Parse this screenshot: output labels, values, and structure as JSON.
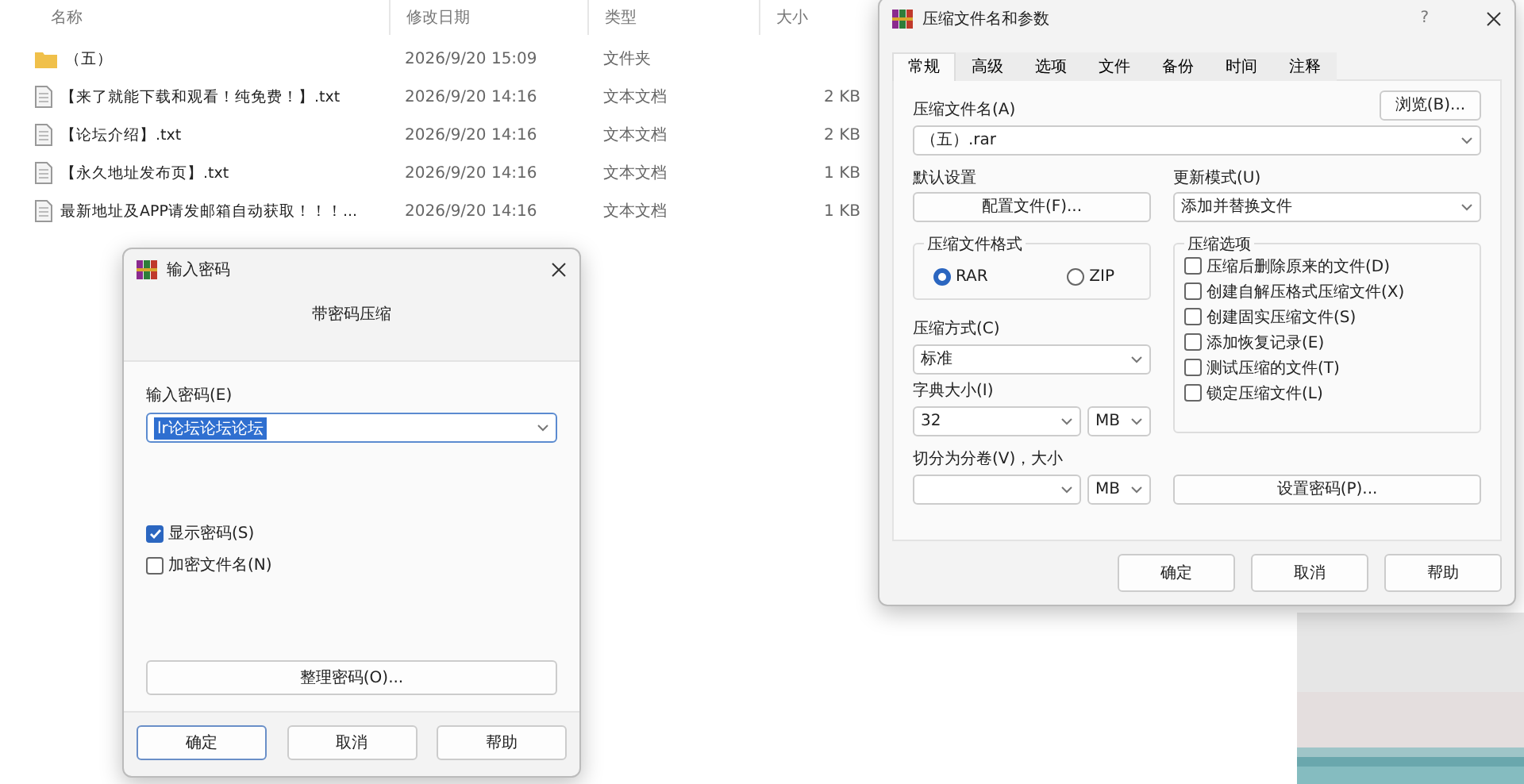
{
  "explorer": {
    "columns": [
      "名称",
      "修改日期",
      "类型",
      "大小"
    ],
    "rows": [
      {
        "kind": "folder",
        "name": "（五）",
        "date": "2026/9/20 15:09",
        "type": "文件夹",
        "size": ""
      },
      {
        "kind": "file",
        "name": "【来了就能下载和观看！纯免费！】.txt",
        "date": "2026/9/20 14:16",
        "type": "文本文档",
        "size": "2 KB"
      },
      {
        "kind": "file",
        "name": "【论坛介绍】.txt",
        "date": "2026/9/20 14:16",
        "type": "文本文档",
        "size": "2 KB"
      },
      {
        "kind": "file",
        "name": "【永久地址发布页】.txt",
        "date": "2026/9/20 14:16",
        "type": "文本文档",
        "size": "1 KB"
      },
      {
        "kind": "file",
        "name": "最新地址及APP请发邮箱自动获取！！！...",
        "date": "2026/9/20 14:16",
        "type": "文本文档",
        "size": "1 KB"
      }
    ]
  },
  "password_dialog": {
    "title": "输入密码",
    "heading": "带密码压缩",
    "field_label": "输入密码(E)",
    "value": "lr论坛论坛论坛",
    "checkboxes": [
      {
        "label": "显示密码(S)",
        "checked": true
      },
      {
        "label": "加密文件名(N)",
        "checked": false
      }
    ],
    "organize_button": "整理密码(O)...",
    "buttons": [
      {
        "label": "确定",
        "selected": true
      },
      {
        "label": "取消",
        "selected": false
      },
      {
        "label": "帮助",
        "selected": false
      }
    ]
  },
  "archive_dialog": {
    "title": "压缩文件名和参数",
    "help": "?",
    "tabs": [
      {
        "label": "常规",
        "selected": true
      },
      {
        "label": "高级",
        "selected": false
      },
      {
        "label": "选项",
        "selected": false
      },
      {
        "label": "文件",
        "selected": false
      },
      {
        "label": "备份",
        "selected": false
      },
      {
        "label": "时间",
        "selected": false
      },
      {
        "label": "注释",
        "selected": false
      }
    ],
    "archive_name_label": "压缩文件名(A)",
    "browse_button": "浏览(B)...",
    "archive_name": "（五）.rar",
    "default_label": "默认设置",
    "profiles_button": "配置文件(F)...",
    "update_label": "更新模式(U)",
    "update_mode": "添加并替换文件",
    "format_label": "压缩文件格式",
    "formats": [
      {
        "label": "RAR",
        "selected": true
      },
      {
        "label": "ZIP",
        "selected": false
      }
    ],
    "method_label": "压缩方式(C)",
    "method": "标准",
    "dict_label": "字典大小(I)",
    "dict": "32",
    "dict_unit": "MB",
    "split_label": "切分为分卷(V)，大小",
    "split_unit": "MB",
    "options_label": "压缩选项",
    "options": [
      {
        "label": "压缩后删除原来的文件(D)",
        "checked": false
      },
      {
        "label": "创建自解压格式压缩文件(X)",
        "checked": false
      },
      {
        "label": "创建固实压缩文件(S)",
        "checked": false
      },
      {
        "label": "添加恢复记录(E)",
        "checked": false
      },
      {
        "label": "测试压缩的文件(T)",
        "checked": false
      },
      {
        "label": "锁定压缩文件(L)",
        "checked": false
      }
    ],
    "password_button": "设置密码(P)...",
    "buttons": [
      "确定",
      "取消",
      "帮助"
    ]
  }
}
